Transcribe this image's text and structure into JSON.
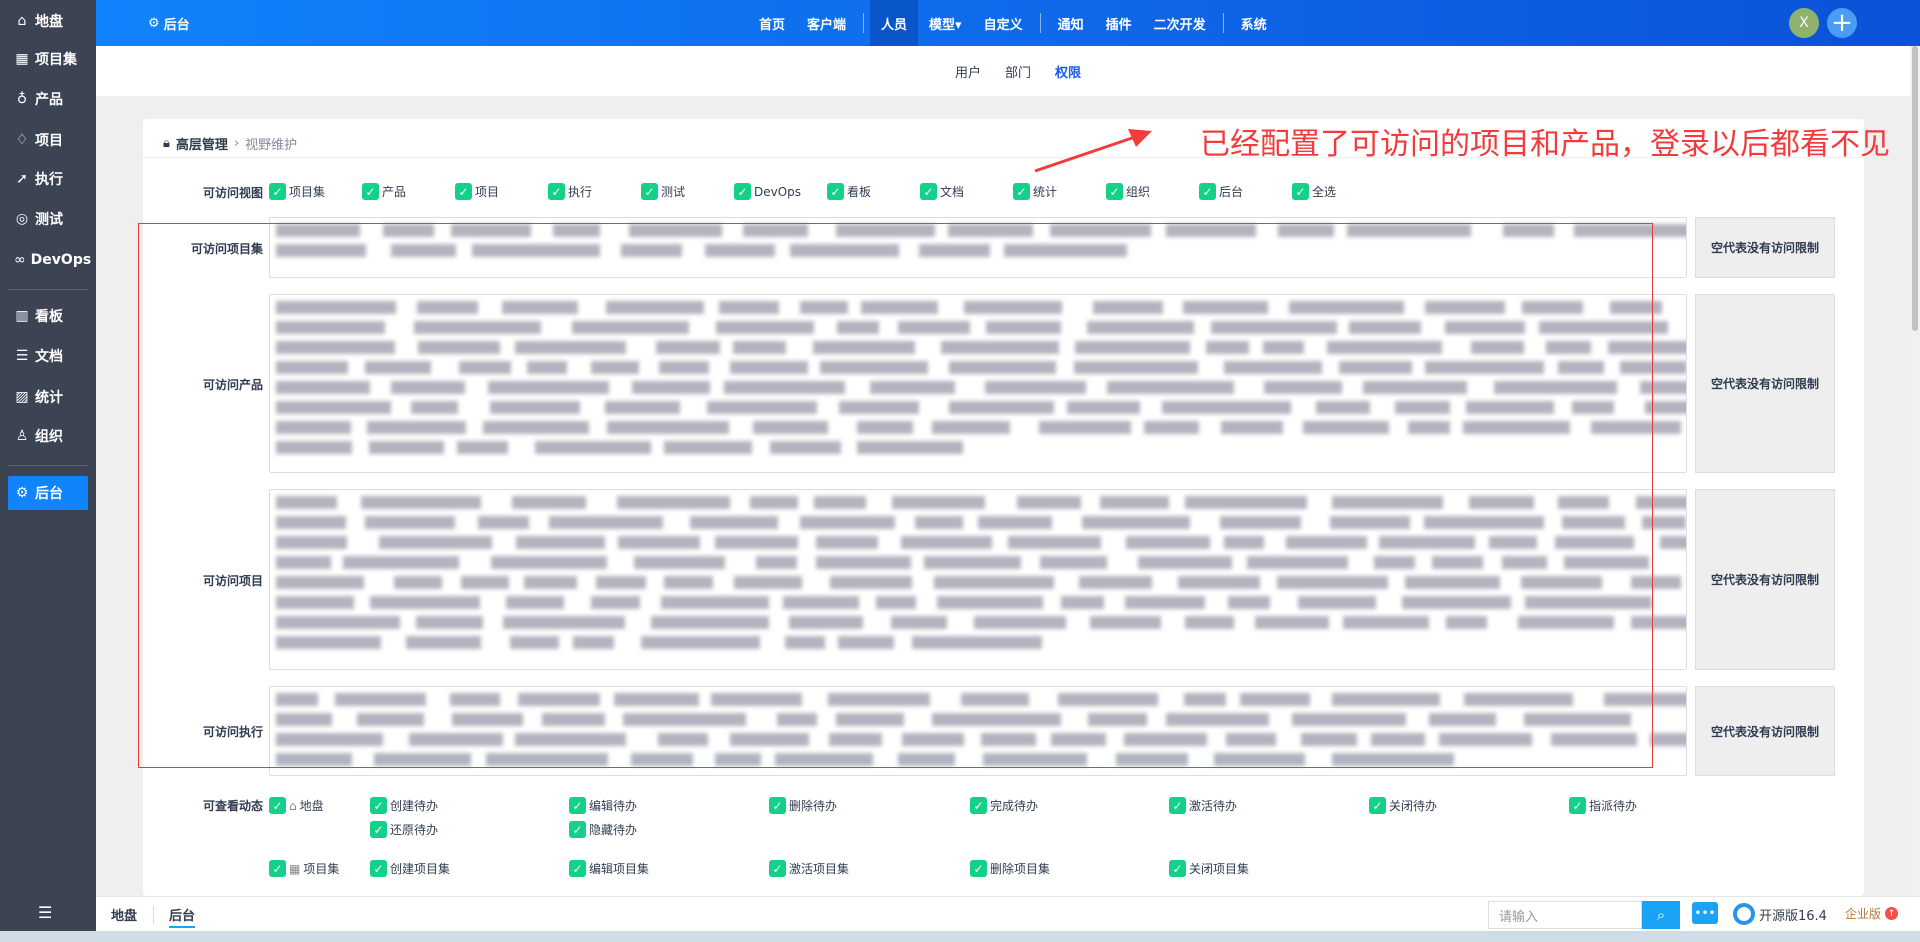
{
  "sidebar": {
    "items": [
      {
        "label": "地盘",
        "icon": "home-icon",
        "glyph": "⌂"
      },
      {
        "label": "项目集",
        "icon": "grid-icon",
        "glyph": "▦"
      },
      {
        "label": "产品",
        "icon": "bulb-icon",
        "glyph": "♁"
      },
      {
        "label": "项目",
        "icon": "rocket-icon",
        "glyph": "♢"
      },
      {
        "label": "执行",
        "icon": "run-icon",
        "glyph": "➚"
      },
      {
        "label": "测试",
        "icon": "test-icon",
        "glyph": "◎"
      },
      {
        "label": "DevOps",
        "icon": "infinity-icon",
        "glyph": "∞"
      },
      {
        "label": "看板",
        "icon": "kanban-icon",
        "glyph": "▥"
      },
      {
        "label": "文档",
        "icon": "doc-icon",
        "glyph": "☰"
      },
      {
        "label": "统计",
        "icon": "chart-icon",
        "glyph": "▨"
      },
      {
        "label": "组织",
        "icon": "people-icon",
        "glyph": "♙"
      },
      {
        "label": "后台",
        "icon": "gear-icon",
        "glyph": "⚙"
      }
    ],
    "active": "后台"
  },
  "topbar": {
    "title": "后台",
    "nav": [
      "首页",
      "客户端",
      "|",
      "人员",
      "模型▾",
      "自定义",
      "|",
      "通知",
      "插件",
      "二次开发",
      "|",
      "系统"
    ],
    "active": "人员",
    "avatar": "X"
  },
  "subnav": {
    "items": [
      "用户",
      "部门",
      "权限"
    ],
    "active": "权限"
  },
  "breadcrumb": {
    "parent": "高层管理",
    "current": "视野维护"
  },
  "annotation": "已经配置了可访问的项目和产品，登录以后都看不见",
  "views": {
    "label": "可访问视图",
    "items": [
      "项目集",
      "产品",
      "项目",
      "执行",
      "测试",
      "DevOps",
      "看板",
      "文档",
      "统计",
      "组织",
      "后台",
      "全选"
    ]
  },
  "access_rows": [
    {
      "label": "可访问项目集",
      "note": "空代表没有访问限制"
    },
    {
      "label": "可访问产品",
      "note": "空代表没有访问限制"
    },
    {
      "label": "可访问项目",
      "note": "空代表没有访问限制"
    },
    {
      "label": "可访问执行",
      "note": "空代表没有访问限制"
    }
  ],
  "dynamics": {
    "label": "可查看动态",
    "groups": [
      {
        "name": "地盘",
        "items": [
          "创建待办",
          "编辑待办",
          "删除待办",
          "完成待办",
          "激活待办",
          "关闭待办",
          "指派待办",
          "还原待办",
          "隐藏待办"
        ]
      },
      {
        "name": "项目集",
        "items": [
          "创建项目集",
          "编辑项目集",
          "激活项目集",
          "删除项目集",
          "关闭项目集"
        ]
      }
    ]
  },
  "bottom": {
    "tabs": [
      "地盘",
      "后台"
    ],
    "active": "后台",
    "search_placeholder": "请输入",
    "version": "开源版16.4",
    "enterprise": "企业版"
  },
  "colors": {
    "accent": "#1183fb",
    "check": "#13d188",
    "annotation": "#f23b3b"
  }
}
